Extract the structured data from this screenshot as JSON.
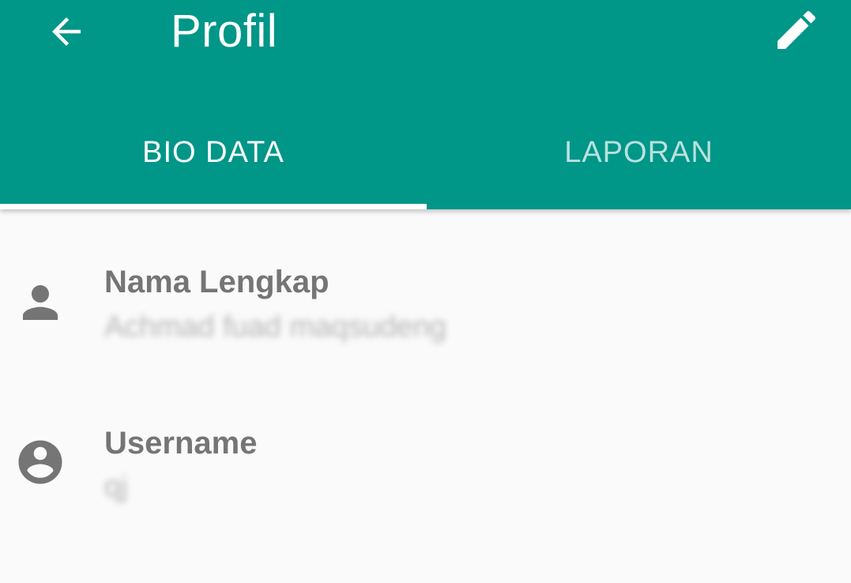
{
  "colors": {
    "primary": "#009688",
    "background": "#fafafa",
    "label": "#757575",
    "icon": "#757575"
  },
  "appbar": {
    "title": "Profil",
    "back_icon": "arrow-back-icon",
    "edit_icon": "pencil-edit-icon"
  },
  "tabs": [
    {
      "label": "BIO DATA",
      "active": true
    },
    {
      "label": "LAPORAN",
      "active": false
    }
  ],
  "fields": [
    {
      "label": "Nama Lengkap",
      "value": "Achmad fuad maqsudeng",
      "icon": "person-icon"
    },
    {
      "label": "Username",
      "value": "qj",
      "icon": "account-circle-icon"
    }
  ]
}
